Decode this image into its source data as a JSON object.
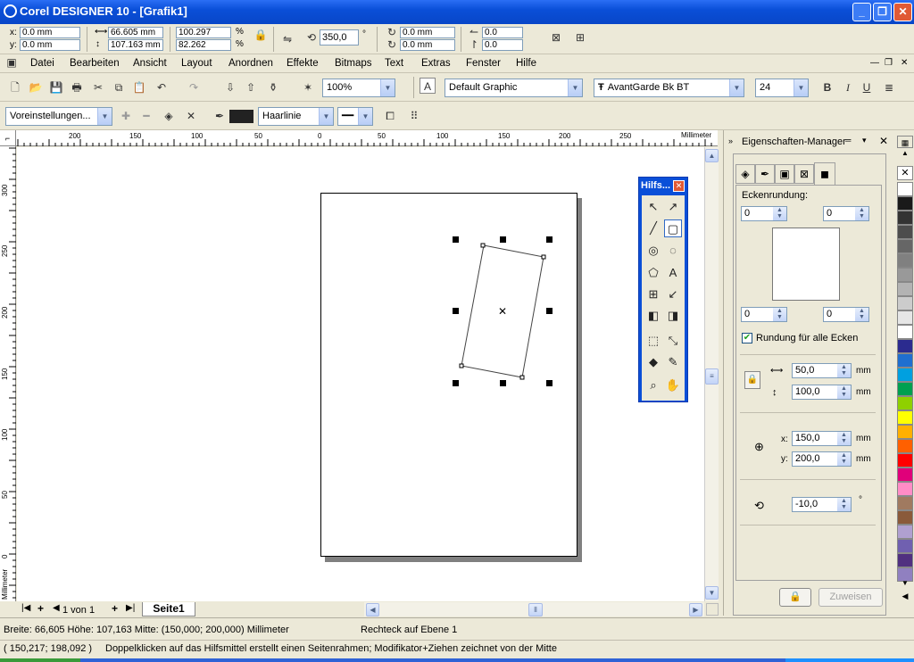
{
  "title": "Corel DESIGNER 10 - [Grafik1]",
  "propbar": {
    "x": "0.0 mm",
    "y": "0.0 mm",
    "x_lbl": "x:",
    "y_lbl": "y:",
    "width": "66.605 mm",
    "height": "107.163 mm",
    "scale_w": "100.297",
    "scale_h": "82.262",
    "pct": "%",
    "angle": "350,0",
    "deg": "°",
    "rot_x": "0.0 mm",
    "rot_y": "0.0 mm",
    "skew_h": "0.0",
    "skew_v": "0.0"
  },
  "menu": [
    "Datei",
    "Bearbeiten",
    "Ansicht",
    "Layout",
    "Anordnen",
    "Effekte",
    "Bitmaps",
    "Text",
    "Extras",
    "Fenster",
    "Hilfe"
  ],
  "std": {
    "zoom": "100%",
    "style": "Default Graphic",
    "font": "AvantGarde Bk BT",
    "size": "24",
    "bold": "B",
    "italic": "I",
    "underline": "U"
  },
  "prop2": {
    "preset": "Voreinstellungen...",
    "outline": "Haarlinie"
  },
  "ruler": {
    "unit": "Millimeter",
    "top_ticks": [
      "200",
      "150",
      "100",
      "50",
      "0",
      "50",
      "100",
      "150",
      "200",
      "250"
    ],
    "left_ticks": [
      "300",
      "250",
      "200",
      "150",
      "100",
      "50",
      "0"
    ]
  },
  "pages": {
    "count": "1 von 1",
    "tab": "Seite1"
  },
  "hilfs": {
    "title": "Hilfs..."
  },
  "docker": {
    "title": "Eigenschaften-Manager",
    "corner_label": "Eckenrundung:",
    "c_tl": "0",
    "c_tr": "0",
    "c_bl": "0",
    "c_br": "0",
    "all_corners": "Rundung für alle Ecken",
    "w": "50,0",
    "h": "100,0",
    "x": "150,0",
    "y": "200,0",
    "x_lbl": "x:",
    "y_lbl": "y:",
    "unit": "mm",
    "angle": "-10,0",
    "deg": "°",
    "apply": "Zuweisen"
  },
  "palette": [
    "#ffffff",
    "#1a1a1a",
    "#333333",
    "#4d4d4d",
    "#666666",
    "#808080",
    "#999999",
    "#b3b3b3",
    "#cccccc",
    "#e6e6e6",
    "#ffffff",
    "#2b2b8f",
    "#1f6fd0",
    "#00a0e0",
    "#00a050",
    "#8fd000",
    "#ffff00",
    "#ffb000",
    "#ff6000",
    "#ff0000",
    "#e0007a",
    "#ff8cc6",
    "#a07a60",
    "#8a5a3a",
    "#b0a0d0",
    "#7060b0",
    "#503080",
    "#9080c0"
  ],
  "status": {
    "line1": "Breite: 66,605  Höhe: 107,163  Mitte: (150,000; 200,000) Millimeter",
    "layer": "Rechteck auf Ebene 1",
    "coords": "( 150,217; 198,092 )",
    "hint": "Doppelklicken auf das Hilfsmittel erstellt einen Seitenrahmen; Modifikator+Ziehen zeichnet von der Mitte"
  }
}
